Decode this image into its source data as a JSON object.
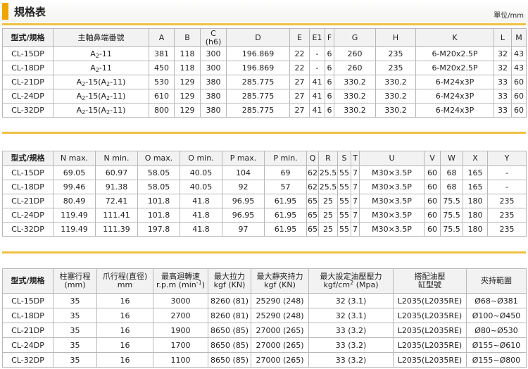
{
  "header": {
    "title": "規格表",
    "unit": "單位/mm"
  },
  "table1": {
    "headers": [
      "型式/規格",
      "主軸鼻端番號",
      "A",
      "B",
      "C",
      "(h6)",
      "D",
      "E",
      "E1",
      "F",
      "G",
      "H",
      "K",
      "L",
      "M"
    ],
    "rows": [
      [
        "CL-15DP",
        "A",
        "2",
        "-11",
        "",
        "",
        "381",
        "118",
        "300",
        "196.869",
        "22",
        "-",
        "6",
        "260",
        "235",
        "6-M20x2.5P",
        "32",
        "43"
      ],
      [
        "CL-18DP",
        "A",
        "2",
        "-11",
        "",
        "",
        "450",
        "118",
        "300",
        "196.869",
        "22",
        "-",
        "6",
        "260",
        "235",
        "6-M20x2.5P",
        "32",
        "43"
      ],
      [
        "CL-21DP",
        "A",
        "2",
        "-15(A",
        "2",
        "-11)",
        "530",
        "129",
        "380",
        "285.775",
        "27",
        "41",
        "6",
        "330.2",
        "330.2",
        "6-M24x3P",
        "33",
        "60"
      ],
      [
        "CL-24DP",
        "A",
        "2",
        "-15(A",
        "2",
        "-11)",
        "610",
        "129",
        "380",
        "285.775",
        "27",
        "41",
        "6",
        "330.2",
        "330.2",
        "6-M24x3P",
        "33",
        "60"
      ],
      [
        "CL-32DP",
        "A",
        "2",
        "-15(A",
        "2",
        "-11)",
        "800",
        "129",
        "380",
        "285.775",
        "27",
        "41",
        "6",
        "330.2",
        "330.2",
        "6-M24x3P",
        "33",
        "60"
      ]
    ]
  },
  "table2": {
    "headers": [
      "型式/規格",
      "N max.",
      "N min.",
      "O max.",
      "O min.",
      "P max.",
      "P min.",
      "Q",
      "R",
      "S",
      "T",
      "U",
      "V",
      "W",
      "X",
      "Y"
    ],
    "rows": [
      [
        "CL-15DP",
        "69.05",
        "60.97",
        "58.05",
        "40.05",
        "104",
        "69",
        "62",
        "25.5",
        "55",
        "7",
        "M30×3.5P",
        "60",
        "68",
        "165",
        "-"
      ],
      [
        "CL-18DP",
        "99.46",
        "91.38",
        "58.05",
        "40.05",
        "92",
        "57",
        "62",
        "25.5",
        "55",
        "7",
        "M30×3.5P",
        "60",
        "68",
        "165",
        "-"
      ],
      [
        "CL-21DP",
        "80.49",
        "72.41",
        "101.8",
        "41.8",
        "96.95",
        "61.95",
        "65",
        "25",
        "55",
        "7",
        "M30×3.5P",
        "60",
        "75.5",
        "180",
        "235"
      ],
      [
        "CL-24DP",
        "119.49",
        "111.41",
        "101.8",
        "41.8",
        "96.95",
        "61.95",
        "65",
        "25",
        "55",
        "7",
        "M30×3.5P",
        "60",
        "75.5",
        "180",
        "235"
      ],
      [
        "CL-32DP",
        "119.49",
        "111.39",
        "197.8",
        "41.8",
        "97",
        "61.95",
        "65",
        "25",
        "55",
        "7",
        "M30×3.5P",
        "60",
        "75.5",
        "180",
        "235"
      ]
    ]
  },
  "table3": {
    "headers": [
      "型式/規格",
      "柱塞行程",
      "(mm)",
      "爪行程(直徑)",
      "mm",
      "最高迴轉速",
      "r.p.m (min",
      "-1",
      ")",
      "最大拉力",
      "kgf (KN)",
      "最大靜夾持力",
      "kgf (KN)",
      "最大設定油壓壓力",
      "kgf/cm",
      "2",
      " (Mpa)",
      "搭配油壓",
      "缸型號",
      "夾持範圍"
    ],
    "rows": [
      [
        "CL-15DP",
        "35",
        "16",
        "3000",
        "8260 (81)",
        "25290 (248)",
        "32 (3.1)",
        "L2035(L2035RE)",
        "Ø68~Ø381"
      ],
      [
        "CL-18DP",
        "35",
        "16",
        "2700",
        "8260 (81)",
        "25290 (248)",
        "32 (3.1)",
        "L2035(L2035RE)",
        "Ø100~Ø450"
      ],
      [
        "CL-21DP",
        "35",
        "16",
        "1900",
        "8650 (85)",
        "27000 (265)",
        "33 (3.2)",
        "L2035(L2035RE)",
        "Ø80~Ø530"
      ],
      [
        "CL-24DP",
        "35",
        "16",
        "1700",
        "8650 (85)",
        "27000 (265)",
        "33 (3.2)",
        "L2035(L2035RE)",
        "Ø155~Ø610"
      ],
      [
        "CL-32DP",
        "35",
        "16",
        "1100",
        "8650 (85)",
        "27000 (265)",
        "33 (3.2)",
        "L2035(L2035RE)",
        "Ø155~Ø800"
      ]
    ]
  },
  "colors": {
    "accent": "#f0a500",
    "separator": "#f0c040",
    "header_bg": "#f2f2f2",
    "border": "#b8b8b8"
  }
}
